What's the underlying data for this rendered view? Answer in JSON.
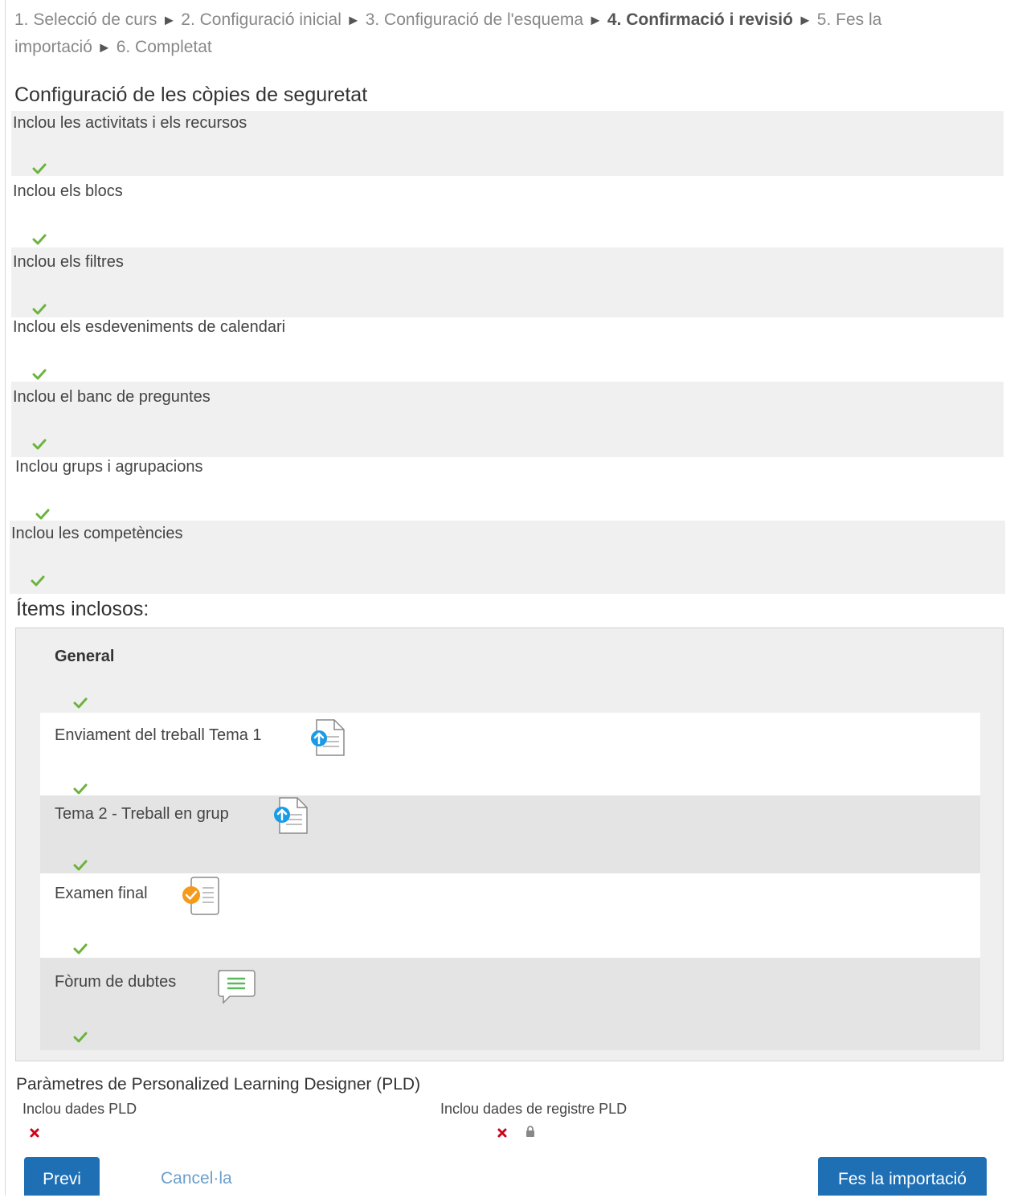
{
  "breadcrumb": {
    "steps": [
      "1. Selecció de curs",
      "2. Configuració inicial",
      "3. Configuració de l'esquema",
      "4. Confirmació i revisió",
      "5. Fes la importació",
      "6. Completat"
    ],
    "separator": "►",
    "current_step": "4. Confirmació i revisió"
  },
  "backup_settings": {
    "title": "Configuració de les còpies de seguretat",
    "items": [
      {
        "label": "Inclou les activitats i els recursos",
        "checked": true
      },
      {
        "label": "Inclou els blocs",
        "checked": true
      },
      {
        "label": "Inclou els filtres",
        "checked": true
      },
      {
        "label": "Inclou els esdeveniments de calendari",
        "checked": true
      },
      {
        "label": "Inclou el banc de preguntes",
        "checked": true
      },
      {
        "label": "Inclou grups i agrupacions",
        "checked": true
      },
      {
        "label": "Inclou les competències",
        "checked": true
      }
    ]
  },
  "included_items": {
    "title": "Ítems inclosos:",
    "section": {
      "label": "General",
      "checked": true
    },
    "activities": [
      {
        "label": "Enviament del treball Tema 1",
        "icon": "assignment-upload-icon",
        "checked": true
      },
      {
        "label": "Tema 2 - Treball en grup",
        "icon": "assignment-upload-icon",
        "checked": true
      },
      {
        "label": "Examen final",
        "icon": "quiz-icon",
        "checked": true
      },
      {
        "label": "Fòrum de dubtes",
        "icon": "forum-icon",
        "checked": true
      }
    ]
  },
  "pld": {
    "title": "Paràmetres de Personalized Learning Designer (PLD)",
    "include_data": {
      "label": "Inclou dades PLD",
      "checked": false
    },
    "include_log": {
      "label": "Inclou dades de registre PLD",
      "checked": false,
      "locked": true
    }
  },
  "buttons": {
    "previous": "Previ",
    "cancel": "Cancel·la",
    "import": "Fes la importació"
  },
  "colors": {
    "check": "#6cb33e",
    "cross": "#d0021b",
    "primary": "#1f6fb5",
    "link": "#6b9fcc",
    "upload_icon": "#1a9be6",
    "quiz_icon": "#f59a1b",
    "forum_icon": "#5cb85c"
  }
}
